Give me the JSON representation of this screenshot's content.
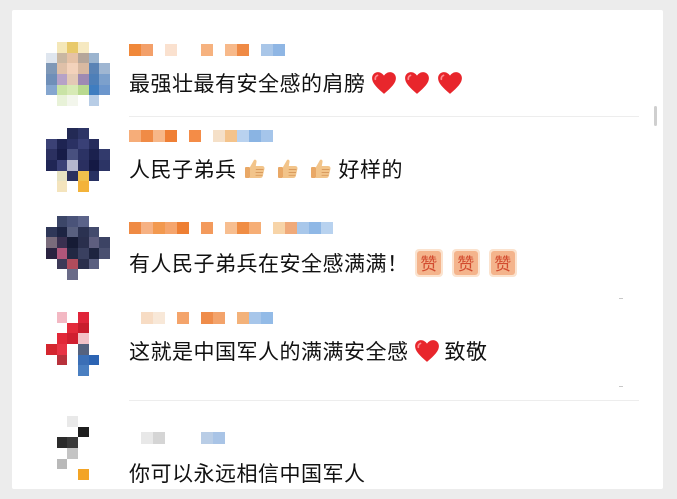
{
  "comments": [
    {
      "text": "最强壮最有安全感的肩膀",
      "emoji": [
        "heart",
        "heart",
        "heart"
      ],
      "emoji_after": ""
    },
    {
      "text": "人民子弟兵",
      "emoji": [
        "thumbs-up",
        "thumbs-up",
        "thumbs-up"
      ],
      "emoji_after": "好样的"
    },
    {
      "text": "有人民子弟兵在安全感满满！",
      "emoji": [
        "zan-sticker",
        "zan-sticker",
        "zan-sticker"
      ],
      "emoji_after": ""
    },
    {
      "text": "这就是中国军人的满满安全感",
      "emoji": [
        "heart"
      ],
      "emoji_after": "致敬"
    },
    {
      "text": "你可以永远相信中国军人",
      "emoji": [],
      "emoji_after": ""
    }
  ],
  "colors": {
    "heart": "#e8262c",
    "thumb": "#f2c48a",
    "zan": "#d9573e"
  },
  "icons": {
    "heart": "heart-icon",
    "thumbs-up": "thumbs-up-icon",
    "zan-sticker": "zan-sticker-icon"
  },
  "zan_char": "赞"
}
